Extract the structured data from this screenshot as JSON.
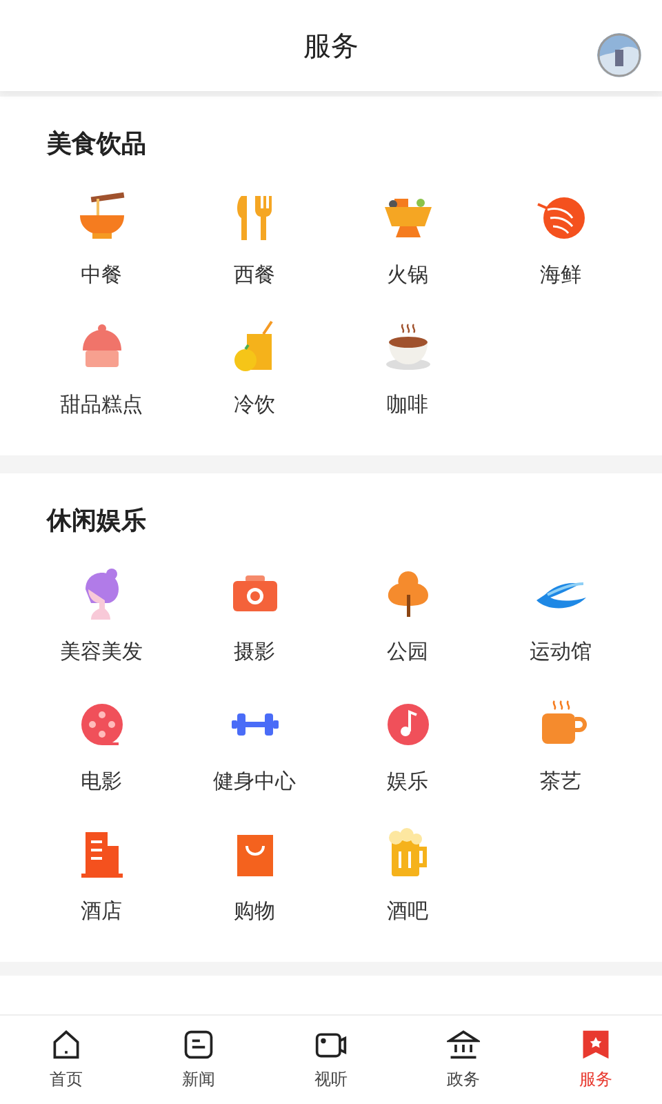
{
  "header": {
    "title": "服务"
  },
  "sections": [
    {
      "title": "美食饮品",
      "items": [
        {
          "label": "中餐"
        },
        {
          "label": "西餐"
        },
        {
          "label": "火锅"
        },
        {
          "label": "海鲜"
        },
        {
          "label": "甜品糕点"
        },
        {
          "label": "冷饮"
        },
        {
          "label": "咖啡"
        }
      ]
    },
    {
      "title": "休闲娱乐",
      "items": [
        {
          "label": "美容美发"
        },
        {
          "label": "摄影"
        },
        {
          "label": "公园"
        },
        {
          "label": "运动馆"
        },
        {
          "label": "电影"
        },
        {
          "label": "健身中心"
        },
        {
          "label": "娱乐"
        },
        {
          "label": "茶艺"
        },
        {
          "label": "酒店"
        },
        {
          "label": "购物"
        },
        {
          "label": "酒吧"
        }
      ]
    }
  ],
  "nav": [
    {
      "label": "首页",
      "selected": false
    },
    {
      "label": "新闻",
      "selected": false
    },
    {
      "label": "视听",
      "selected": false
    },
    {
      "label": "政务",
      "selected": false
    },
    {
      "label": "服务",
      "selected": true
    }
  ]
}
